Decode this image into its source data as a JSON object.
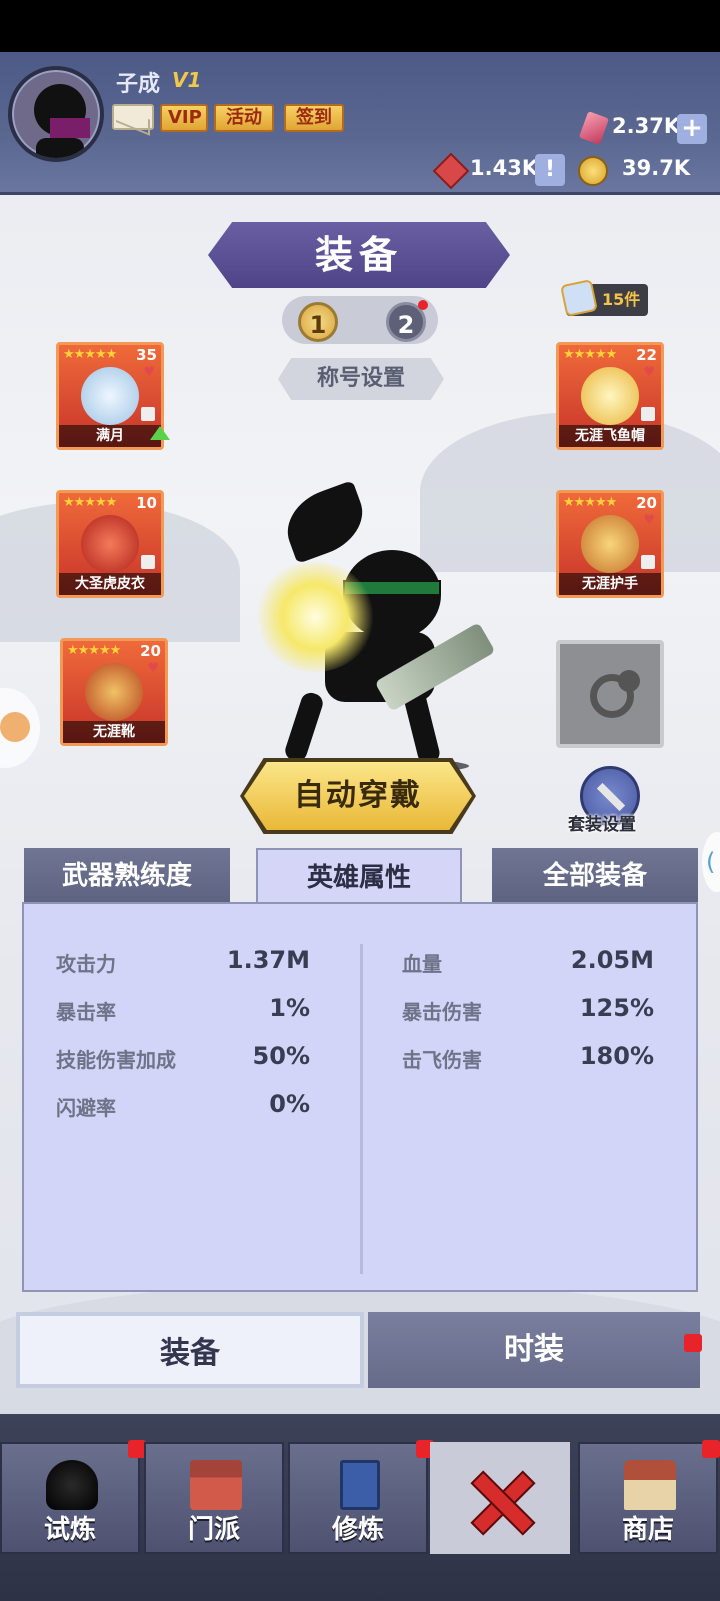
{
  "player": {
    "name": "子成",
    "vip_level": "V1"
  },
  "top_buttons": {
    "vip": "VIP",
    "activity": "活动",
    "signin": "签到"
  },
  "resources": {
    "gems": "2.37K",
    "tickets": "1.43K",
    "coins": "39.7K"
  },
  "header": {
    "title": "装备",
    "page1": "1",
    "page2": "2",
    "title_setting": "称号设置",
    "item_count": "15件"
  },
  "equipment": [
    {
      "stars": "★★★★★",
      "level": "35",
      "name": "满月",
      "color": "#c9dff0"
    },
    {
      "stars": "★★★★★",
      "level": "10",
      "name": "大圣虎皮衣",
      "color": "#e23b2f"
    },
    {
      "stars": "★★★★★",
      "level": "20",
      "name": "无涯靴",
      "color": "#d84a3a"
    },
    {
      "stars": "★★★★★",
      "level": "22",
      "name": "无涯飞鱼帽",
      "color": "#f2d56a"
    },
    {
      "stars": "★★★★★",
      "level": "20",
      "name": "无涯护手",
      "color": "#e4a03e"
    }
  ],
  "actions": {
    "auto_equip": "自动穿戴",
    "set_config": "套装设置"
  },
  "panel_tabs": {
    "mastery": "武器熟练度",
    "hero_attr": "英雄属性",
    "all_equip": "全部装备"
  },
  "stats_left": [
    {
      "label": "攻击力",
      "value": "1.37M"
    },
    {
      "label": "暴击率",
      "value": "1%"
    },
    {
      "label": "技能伤害加成",
      "value": "50%"
    },
    {
      "label": "闪避率",
      "value": "0%"
    }
  ],
  "stats_right": [
    {
      "label": "血量",
      "value": "2.05M"
    },
    {
      "label": "暴击伤害",
      "value": "125%"
    },
    {
      "label": "击飞伤害",
      "value": "180%"
    }
  ],
  "lower_tabs": {
    "equip": "装备",
    "fashion": "时装"
  },
  "nav": {
    "trial": "试炼",
    "sect": "门派",
    "cultivate": "修炼",
    "shop": "商店"
  },
  "colors": {
    "topbar": "#4c5a86",
    "accent_gold": "#e9b838",
    "slot_red": "#c7342a",
    "panel": "#d3d5f8"
  }
}
